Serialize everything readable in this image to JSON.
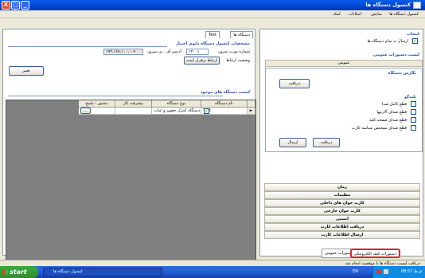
{
  "window": {
    "title": "کنسول دستگاه ها",
    "min_glyph": "_",
    "max_glyph": "□",
    "close_glyph": "X"
  },
  "menu": [
    "کنسول دستگاه ها",
    "نمایش",
    "امکانات",
    "کمک"
  ],
  "left": {
    "tab_label": "دستگاه ها",
    "device_tab": "Test",
    "specs_title": "مشخصات کنسول دستگاه بانوی اختیار",
    "port_label": "شماره پورت سرور",
    "port_value": "۱۲۰۰۱",
    "ip_label": "آدرس آی . پی سرور",
    "ip_value": "۱۹۲،۱۶۸،۱۰۰،۰۰۹",
    "conn_label": "وضعیت ارتباط",
    "conn_button": "ارتباط برقرار است",
    "change_button": "تغییر",
    "devices_title": "لیست دستگاه های موجود",
    "columns": [
      "نام دستگاه",
      "نوع دستگاه",
      "پیشرفت کار",
      "دستور - پاسخ"
    ],
    "row": {
      "name": "Test",
      "checked": "✓",
      "type": "دستگاه کنترل حضور و غیاب",
      "progress": "",
      "action": "..."
    }
  },
  "right": {
    "select_title": "انتخاب",
    "send_all": "ارسال به تمام دستگاه ها",
    "send_all_checked": "✓",
    "commands_title": "لیست دستورات عمومی",
    "general_bar": "عمومی",
    "report_title": "نگارش دستگاه",
    "receive_button": "دریافت",
    "speaker_title": "بلندگو",
    "checkboxes": [
      "قطع کامل صدا",
      "قطع صدای آلارمها",
      "قطع صدای صفحه کلید",
      "قطع صدای تشخیص شناسه کارت"
    ],
    "receive_button2": "دریافت",
    "send_button": "ارسال",
    "list": [
      "زمان",
      "تنظیمات",
      "کارت خوان های داخلی",
      "کارت خوان خارجی",
      "امنیتی",
      "دریافت اطلاعات کارت",
      "ارسال اطلاعات کارت"
    ]
  },
  "bottom_tabs": [
    "دستورات عمومی",
    "دستورات کیف الکترونیکی"
  ],
  "status": "دریافت لیست دستگاه ها با موفقیت انجام شد",
  "taskbar": {
    "start": "start",
    "task": "کنسول دستگاه ها",
    "lang": "EN",
    "time": "08:57 ق.ظ"
  }
}
